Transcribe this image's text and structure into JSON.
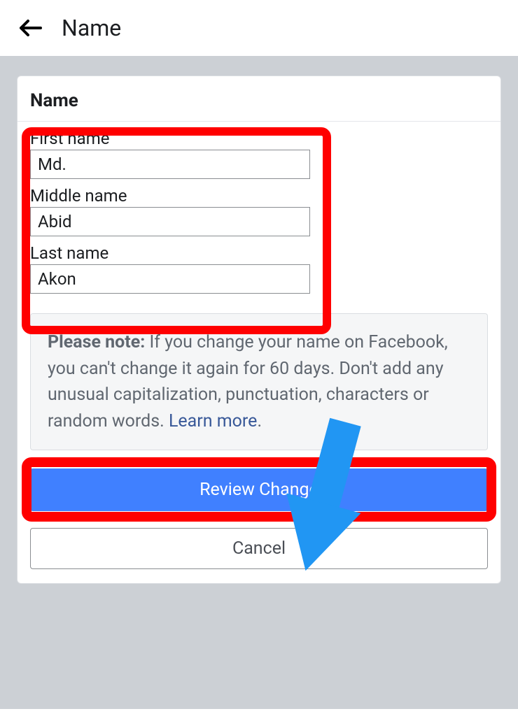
{
  "header": {
    "title": "Name"
  },
  "section": {
    "title": "Name"
  },
  "fields": {
    "first": {
      "label": "First name",
      "value": "Md."
    },
    "middle": {
      "label": "Middle name",
      "value": "Abid"
    },
    "last": {
      "label": "Last name",
      "value": "Akon"
    }
  },
  "note": {
    "strong": "Please note:",
    "body": " If you change your name on Facebook, you can't change it again for 60 days. Don't add any unusual capitalization, punctuation, characters or random words. ",
    "link": "Learn more",
    "after": "."
  },
  "buttons": {
    "review": "Review Change",
    "cancel": "Cancel"
  },
  "colors": {
    "primary": "#4080ff",
    "highlight": "#ff0000",
    "arrow": "#2196f3"
  }
}
